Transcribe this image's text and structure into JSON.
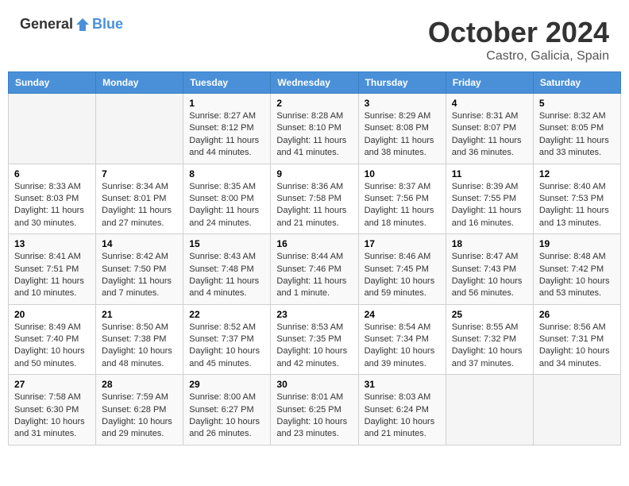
{
  "header": {
    "logo_general": "General",
    "logo_blue": "Blue",
    "month": "October 2024",
    "location": "Castro, Galicia, Spain"
  },
  "days_of_week": [
    "Sunday",
    "Monday",
    "Tuesday",
    "Wednesday",
    "Thursday",
    "Friday",
    "Saturday"
  ],
  "weeks": [
    [
      {
        "day": "",
        "info": ""
      },
      {
        "day": "",
        "info": ""
      },
      {
        "day": "1",
        "sunrise": "Sunrise: 8:27 AM",
        "sunset": "Sunset: 8:12 PM",
        "daylight": "Daylight: 11 hours and 44 minutes."
      },
      {
        "day": "2",
        "sunrise": "Sunrise: 8:28 AM",
        "sunset": "Sunset: 8:10 PM",
        "daylight": "Daylight: 11 hours and 41 minutes."
      },
      {
        "day": "3",
        "sunrise": "Sunrise: 8:29 AM",
        "sunset": "Sunset: 8:08 PM",
        "daylight": "Daylight: 11 hours and 38 minutes."
      },
      {
        "day": "4",
        "sunrise": "Sunrise: 8:31 AM",
        "sunset": "Sunset: 8:07 PM",
        "daylight": "Daylight: 11 hours and 36 minutes."
      },
      {
        "day": "5",
        "sunrise": "Sunrise: 8:32 AM",
        "sunset": "Sunset: 8:05 PM",
        "daylight": "Daylight: 11 hours and 33 minutes."
      }
    ],
    [
      {
        "day": "6",
        "sunrise": "Sunrise: 8:33 AM",
        "sunset": "Sunset: 8:03 PM",
        "daylight": "Daylight: 11 hours and 30 minutes."
      },
      {
        "day": "7",
        "sunrise": "Sunrise: 8:34 AM",
        "sunset": "Sunset: 8:01 PM",
        "daylight": "Daylight: 11 hours and 27 minutes."
      },
      {
        "day": "8",
        "sunrise": "Sunrise: 8:35 AM",
        "sunset": "Sunset: 8:00 PM",
        "daylight": "Daylight: 11 hours and 24 minutes."
      },
      {
        "day": "9",
        "sunrise": "Sunrise: 8:36 AM",
        "sunset": "Sunset: 7:58 PM",
        "daylight": "Daylight: 11 hours and 21 minutes."
      },
      {
        "day": "10",
        "sunrise": "Sunrise: 8:37 AM",
        "sunset": "Sunset: 7:56 PM",
        "daylight": "Daylight: 11 hours and 18 minutes."
      },
      {
        "day": "11",
        "sunrise": "Sunrise: 8:39 AM",
        "sunset": "Sunset: 7:55 PM",
        "daylight": "Daylight: 11 hours and 16 minutes."
      },
      {
        "day": "12",
        "sunrise": "Sunrise: 8:40 AM",
        "sunset": "Sunset: 7:53 PM",
        "daylight": "Daylight: 11 hours and 13 minutes."
      }
    ],
    [
      {
        "day": "13",
        "sunrise": "Sunrise: 8:41 AM",
        "sunset": "Sunset: 7:51 PM",
        "daylight": "Daylight: 11 hours and 10 minutes."
      },
      {
        "day": "14",
        "sunrise": "Sunrise: 8:42 AM",
        "sunset": "Sunset: 7:50 PM",
        "daylight": "Daylight: 11 hours and 7 minutes."
      },
      {
        "day": "15",
        "sunrise": "Sunrise: 8:43 AM",
        "sunset": "Sunset: 7:48 PM",
        "daylight": "Daylight: 11 hours and 4 minutes."
      },
      {
        "day": "16",
        "sunrise": "Sunrise: 8:44 AM",
        "sunset": "Sunset: 7:46 PM",
        "daylight": "Daylight: 11 hours and 1 minute."
      },
      {
        "day": "17",
        "sunrise": "Sunrise: 8:46 AM",
        "sunset": "Sunset: 7:45 PM",
        "daylight": "Daylight: 10 hours and 59 minutes."
      },
      {
        "day": "18",
        "sunrise": "Sunrise: 8:47 AM",
        "sunset": "Sunset: 7:43 PM",
        "daylight": "Daylight: 10 hours and 56 minutes."
      },
      {
        "day": "19",
        "sunrise": "Sunrise: 8:48 AM",
        "sunset": "Sunset: 7:42 PM",
        "daylight": "Daylight: 10 hours and 53 minutes."
      }
    ],
    [
      {
        "day": "20",
        "sunrise": "Sunrise: 8:49 AM",
        "sunset": "Sunset: 7:40 PM",
        "daylight": "Daylight: 10 hours and 50 minutes."
      },
      {
        "day": "21",
        "sunrise": "Sunrise: 8:50 AM",
        "sunset": "Sunset: 7:38 PM",
        "daylight": "Daylight: 10 hours and 48 minutes."
      },
      {
        "day": "22",
        "sunrise": "Sunrise: 8:52 AM",
        "sunset": "Sunset: 7:37 PM",
        "daylight": "Daylight: 10 hours and 45 minutes."
      },
      {
        "day": "23",
        "sunrise": "Sunrise: 8:53 AM",
        "sunset": "Sunset: 7:35 PM",
        "daylight": "Daylight: 10 hours and 42 minutes."
      },
      {
        "day": "24",
        "sunrise": "Sunrise: 8:54 AM",
        "sunset": "Sunset: 7:34 PM",
        "daylight": "Daylight: 10 hours and 39 minutes."
      },
      {
        "day": "25",
        "sunrise": "Sunrise: 8:55 AM",
        "sunset": "Sunset: 7:32 PM",
        "daylight": "Daylight: 10 hours and 37 minutes."
      },
      {
        "day": "26",
        "sunrise": "Sunrise: 8:56 AM",
        "sunset": "Sunset: 7:31 PM",
        "daylight": "Daylight: 10 hours and 34 minutes."
      }
    ],
    [
      {
        "day": "27",
        "sunrise": "Sunrise: 7:58 AM",
        "sunset": "Sunset: 6:30 PM",
        "daylight": "Daylight: 10 hours and 31 minutes."
      },
      {
        "day": "28",
        "sunrise": "Sunrise: 7:59 AM",
        "sunset": "Sunset: 6:28 PM",
        "daylight": "Daylight: 10 hours and 29 minutes."
      },
      {
        "day": "29",
        "sunrise": "Sunrise: 8:00 AM",
        "sunset": "Sunset: 6:27 PM",
        "daylight": "Daylight: 10 hours and 26 minutes."
      },
      {
        "day": "30",
        "sunrise": "Sunrise: 8:01 AM",
        "sunset": "Sunset: 6:25 PM",
        "daylight": "Daylight: 10 hours and 23 minutes."
      },
      {
        "day": "31",
        "sunrise": "Sunrise: 8:03 AM",
        "sunset": "Sunset: 6:24 PM",
        "daylight": "Daylight: 10 hours and 21 minutes."
      },
      {
        "day": "",
        "info": ""
      },
      {
        "day": "",
        "info": ""
      }
    ]
  ]
}
